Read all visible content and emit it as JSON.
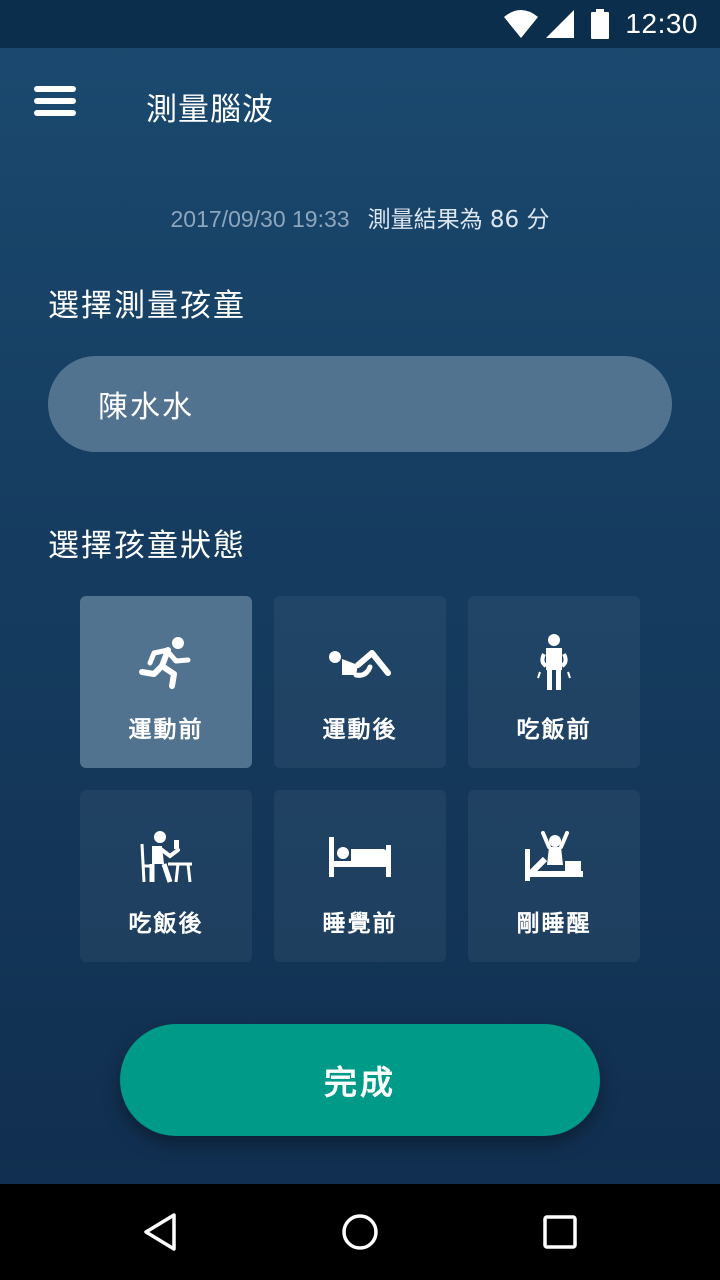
{
  "status_bar": {
    "time": "12:30",
    "icons": [
      "wifi-icon",
      "signal-icon",
      "battery-icon"
    ]
  },
  "header": {
    "title": "測量腦波",
    "menu_icon": "hamburger-menu-icon"
  },
  "result": {
    "timestamp": "2017/09/30 19:33",
    "text": "測量結果為 86 分"
  },
  "child_section": {
    "label": "選擇測量孩童",
    "selected_child": "陳水水"
  },
  "state_section": {
    "label": "選擇孩童狀態",
    "options": [
      {
        "label": "運動前",
        "icon": "running-icon",
        "selected": true
      },
      {
        "label": "運動後",
        "icon": "resting-icon",
        "selected": false
      },
      {
        "label": "吃飯前",
        "icon": "standing-person-icon",
        "selected": false
      },
      {
        "label": "吃飯後",
        "icon": "dining-icon",
        "selected": false
      },
      {
        "label": "睡覺前",
        "icon": "bed-icon",
        "selected": false
      },
      {
        "label": "剛睡醒",
        "icon": "wake-up-icon",
        "selected": false
      }
    ]
  },
  "done_button": {
    "label": "完成"
  },
  "nav_bar": {
    "icons": [
      "back-icon",
      "home-icon",
      "recents-icon"
    ]
  },
  "colors": {
    "accent": "#009a89",
    "selected_card": "#52738f",
    "background": "#163f63"
  }
}
